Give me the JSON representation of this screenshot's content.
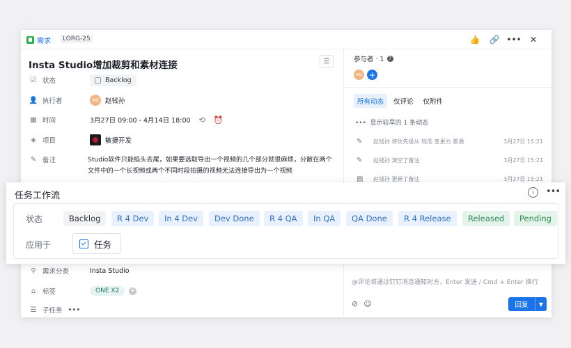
{
  "header": {
    "type_label": "需求",
    "issue_key": "LORG-25",
    "actions": [
      "like-icon",
      "link-icon",
      "more-icon",
      "close-icon"
    ]
  },
  "issue": {
    "title": "Insta Studio增加裁剪和素材连接",
    "fields": {
      "status": {
        "label": "状态",
        "value": "Backlog"
      },
      "assignee": {
        "label": "执行者",
        "avatar": "MG",
        "value": "赵钱孙"
      },
      "time": {
        "label": "时间",
        "value": "3月27日 09:00 - 4月14日 18:00"
      },
      "project": {
        "label": "项目",
        "value": "敏捷开发"
      },
      "note": {
        "label": "备注",
        "value": "Studio软件只能掐头去尾，如果要选取导出一个视频的几个部分就很麻烦，分散在两个文件中的一个长视频或两个不同时段拍摄的视频无法连接导出为一个视频"
      },
      "category": {
        "label": "需求分类",
        "value": "Insta Studio"
      },
      "tags": {
        "label": "标签",
        "value": "ONE X2"
      },
      "subtasks": {
        "label": "子任务"
      }
    }
  },
  "sidebar": {
    "participants_label": "参与者 · 1",
    "participant_avatar": "MG",
    "tabs": [
      "所有动态",
      "仅评论",
      "仅附件"
    ],
    "earlier_label": "显示较早的 1 条动态",
    "activities": [
      {
        "text": "赵钱孙 将优先级从 较低 变更为 普通",
        "time": "3月27日 15:21"
      },
      {
        "text": "赵钱孙 清空了备注",
        "time": "3月27日 15:21"
      },
      {
        "text": "赵钱孙 更新了备注",
        "time": "3月27日 15:21"
      }
    ],
    "comment_placeholder": "@评论将通过钉钉消息通知对方，Enter 发送 / Cmd + Enter 换行",
    "reply_label": "回复"
  },
  "workflow": {
    "title": "任务工作流",
    "status_label": "状态",
    "statuses": [
      {
        "label": "Backlog",
        "color": "grey"
      },
      {
        "label": "R 4 Dev",
        "color": "blue"
      },
      {
        "label": "In 4 Dev",
        "color": "blue"
      },
      {
        "label": "Dev Done",
        "color": "blue"
      },
      {
        "label": "R 4 QA",
        "color": "blue"
      },
      {
        "label": "In QA",
        "color": "blue"
      },
      {
        "label": "QA Done",
        "color": "blue"
      },
      {
        "label": "R 4 Release",
        "color": "blue"
      },
      {
        "label": "Released",
        "color": "green"
      },
      {
        "label": "Pending",
        "color": "green"
      }
    ],
    "apply_label": "应用于",
    "apply_value": "任务"
  }
}
